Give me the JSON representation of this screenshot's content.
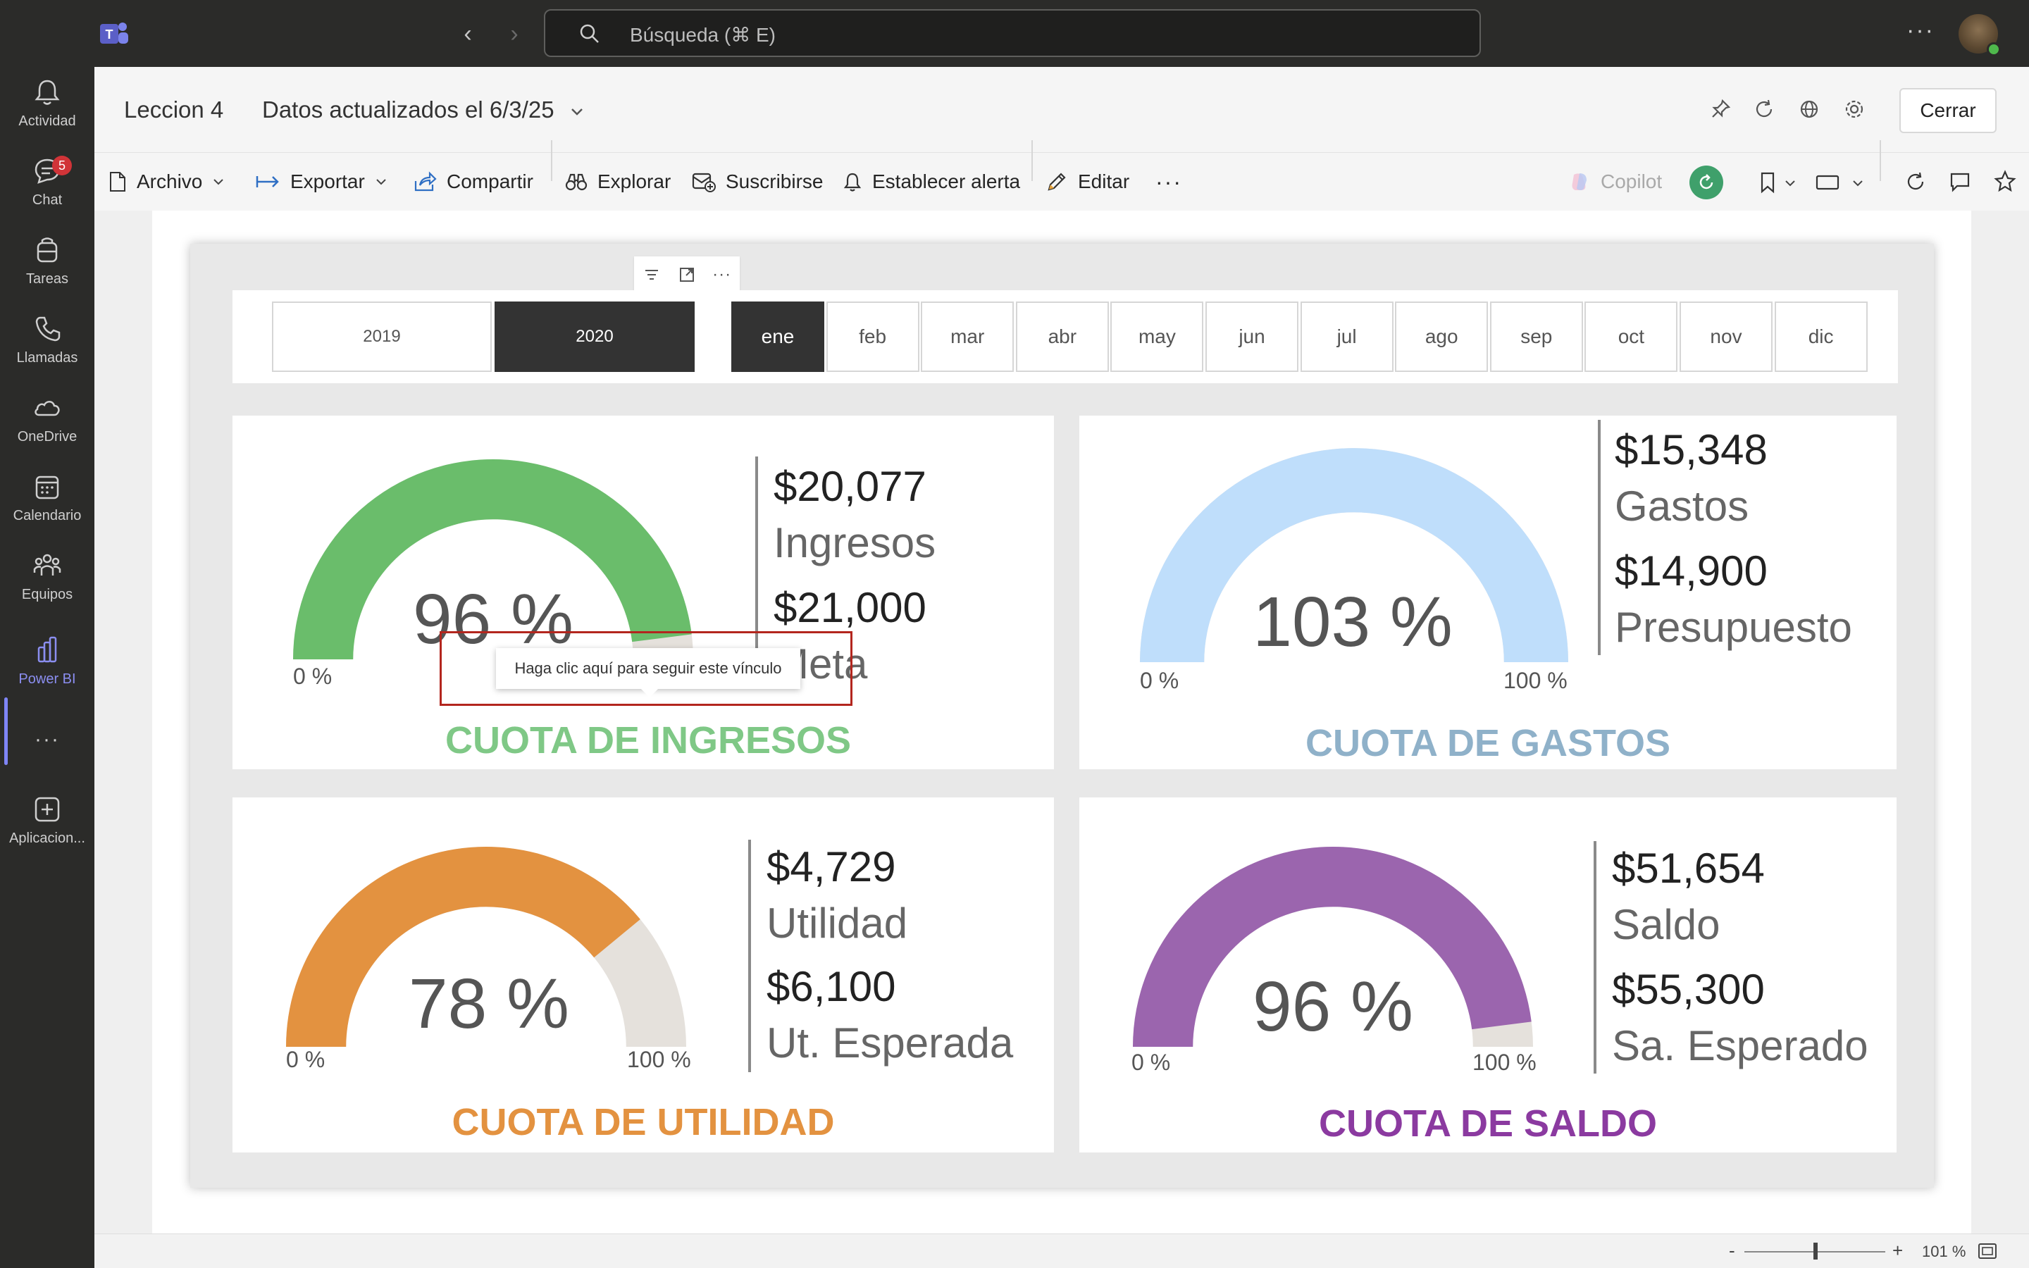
{
  "topbar": {
    "search_placeholder": "Búsqueda (⌘ E)",
    "more": "···"
  },
  "rail": {
    "items": [
      {
        "label": "Actividad",
        "icon": "bell-icon"
      },
      {
        "label": "Chat",
        "icon": "chat-icon",
        "badge": "5"
      },
      {
        "label": "Tareas",
        "icon": "tasks-icon"
      },
      {
        "label": "Llamadas",
        "icon": "phone-icon"
      },
      {
        "label": "OneDrive",
        "icon": "cloud-icon"
      },
      {
        "label": "Calendario",
        "icon": "calendar-icon"
      },
      {
        "label": "Equipos",
        "icon": "teams-icon"
      },
      {
        "label": "Power BI",
        "icon": "powerbi-icon"
      },
      {
        "label": "···",
        "icon": "more-icon"
      },
      {
        "label": "Aplicacion...",
        "icon": "add-app-icon"
      }
    ]
  },
  "header": {
    "title": "Leccion 4",
    "updated": "Datos actualizados el 6/3/25",
    "close": "Cerrar"
  },
  "toolbar": {
    "archivo": "Archivo",
    "exportar": "Exportar",
    "compartir": "Compartir",
    "explorar": "Explorar",
    "suscribirse": "Suscribirse",
    "alerta": "Establecer alerta",
    "editar": "Editar",
    "more": "···",
    "copilot": "Copilot"
  },
  "slicers": {
    "years": [
      {
        "label": "2019",
        "selected": false
      },
      {
        "label": "2020",
        "selected": true
      }
    ],
    "months": [
      {
        "label": "ene",
        "selected": true
      },
      {
        "label": "feb",
        "selected": false
      },
      {
        "label": "mar",
        "selected": false
      },
      {
        "label": "abr",
        "selected": false
      },
      {
        "label": "may",
        "selected": false
      },
      {
        "label": "jun",
        "selected": false
      },
      {
        "label": "jul",
        "selected": false
      },
      {
        "label": "ago",
        "selected": false
      },
      {
        "label": "sep",
        "selected": false
      },
      {
        "label": "oct",
        "selected": false
      },
      {
        "label": "nov",
        "selected": false
      },
      {
        "label": "dic",
        "selected": false
      }
    ]
  },
  "cards": {
    "ingresos": {
      "pct_label": "96 %",
      "fill": 0.96,
      "color": "#6abd6b",
      "min": "0 %",
      "max": "",
      "v1": "$20,077",
      "l1": "Ingresos",
      "v2": "$21,000",
      "l2": "Meta",
      "title": "CUOTA DE INGRESOS",
      "title_color": "#7fc886"
    },
    "gastos": {
      "pct_label": "103 %",
      "fill": 1.0,
      "color": "#bfdefb",
      "min": "0 %",
      "max": "100 %",
      "v1": "$15,348",
      "l1": "Gastos",
      "v2": "$14,900",
      "l2": "Presupuesto",
      "title": "CUOTA DE GASTOS",
      "title_color": "#8fb1c9"
    },
    "utilidad": {
      "pct_label": "78 %",
      "fill": 0.78,
      "color": "#e39240",
      "min": "0 %",
      "max": "100 %",
      "v1": "$4,729",
      "l1": "Utilidad",
      "v2": "$6,100",
      "l2": "Ut. Esperada",
      "title": "CUOTA DE UTILIDAD",
      "title_color": "#e39240"
    },
    "saldo": {
      "pct_label": "96 %",
      "fill": 0.96,
      "color": "#9b65ae",
      "min": "0 %",
      "max": "100 %",
      "v1": "$51,654",
      "l1": "Saldo",
      "v2": "$55,300",
      "l2": "Sa. Esperado",
      "title": "CUOTA DE SALDO",
      "title_color": "#8b3aa0"
    }
  },
  "tooltip": {
    "text": "Haga clic aquí para seguir este vínculo"
  },
  "statusbar": {
    "zoom_minus": "-",
    "zoom_plus": "+",
    "zoom": "101 %"
  },
  "colors": {
    "gauge_track": "#e5e1dc",
    "slicer_selected": "#333333"
  }
}
